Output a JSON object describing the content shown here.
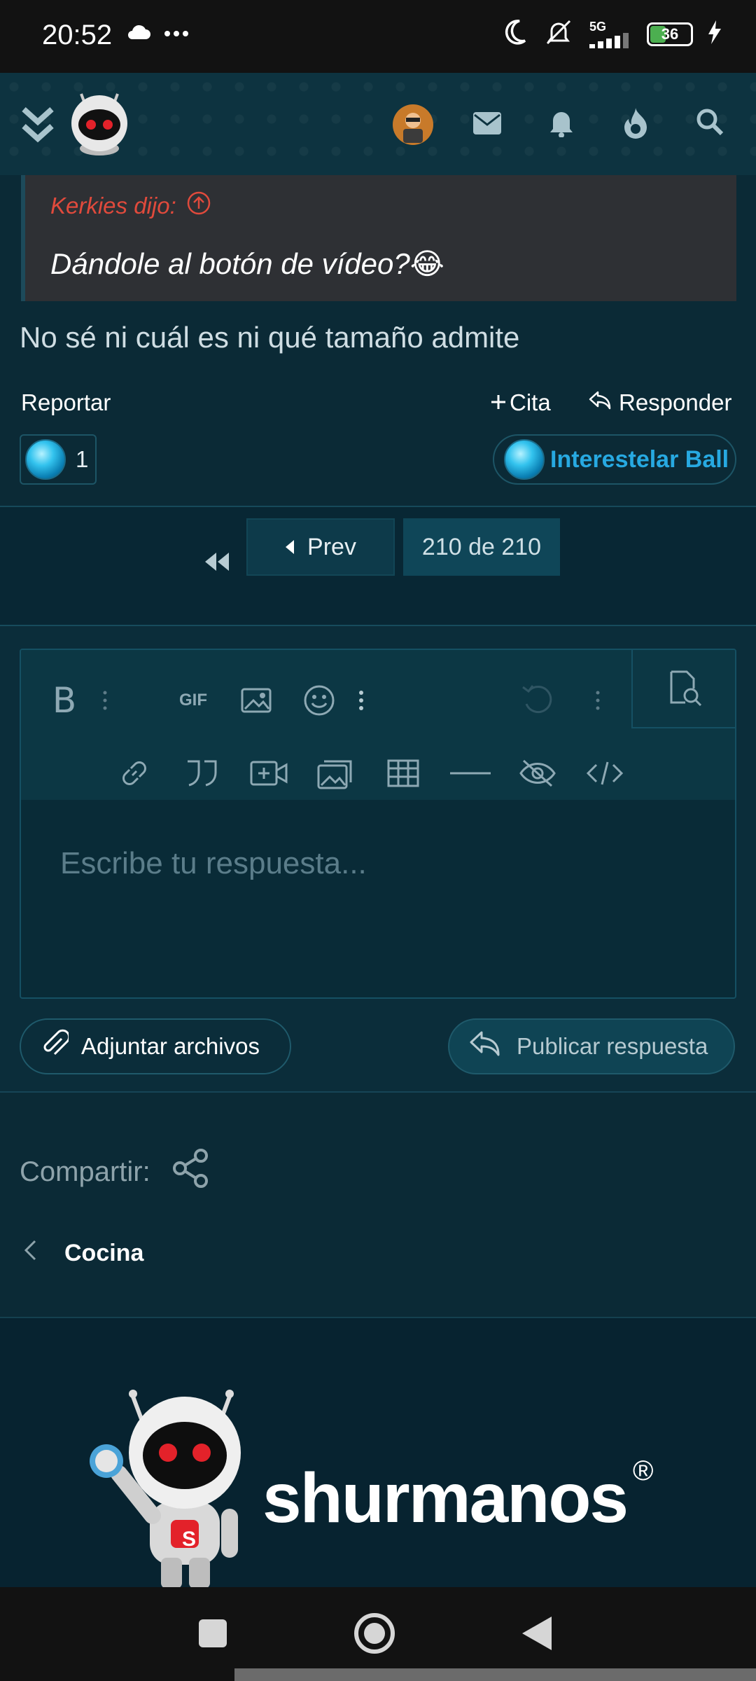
{
  "status_bar": {
    "time": "20:52",
    "network": "5G",
    "battery": "36"
  },
  "quote": {
    "author": "Kerkies dijo:",
    "text": "Dándole al botón de vídeo?",
    "emoji": "😂"
  },
  "post": {
    "text": "No sé ni cuál es ni qué tamaño admite",
    "report_label": "Reportar",
    "quote_label": "Cita",
    "reply_label": "Responder",
    "reaction_count": "1",
    "reaction_name": "Interestelar Ball"
  },
  "pagination": {
    "prev_label": "Prev",
    "current": "210 de 210"
  },
  "editor": {
    "placeholder": "Escribe tu respuesta...",
    "gif_label": "GIF"
  },
  "buttons": {
    "attach": "Adjuntar archivos",
    "publish": "Publicar respuesta"
  },
  "share_label": "Compartir:",
  "breadcrumb": "Cocina",
  "footer": {
    "brand": "shurmanos",
    "registered": "®",
    "badge_letter": "S"
  },
  "colors": {
    "accent": "#27a9e1",
    "quote_author": "#e04a3c",
    "background": "#0b2a36"
  }
}
